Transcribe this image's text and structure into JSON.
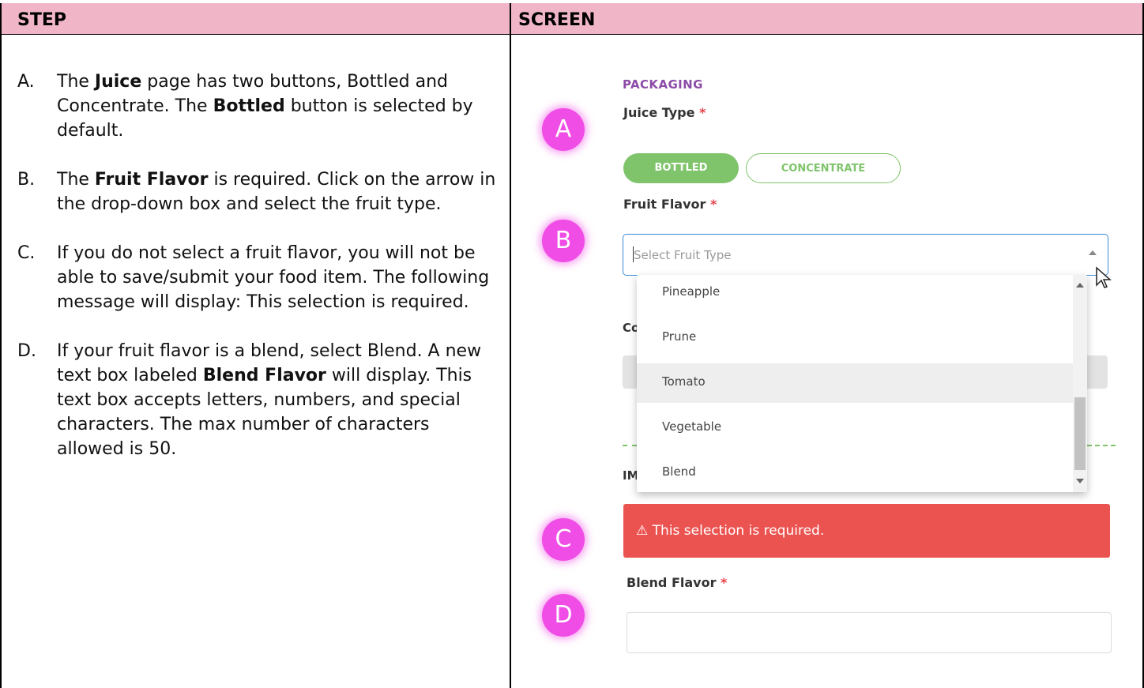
{
  "table": {
    "header_step": "STEP",
    "header_screen": "SCREEN"
  },
  "steps": [
    {
      "letter": "A.",
      "parts": [
        "The ",
        "Juice",
        " page has two buttons, Bottled and Concentrate.  The ",
        "Bottled",
        " button is selected by default."
      ]
    },
    {
      "letter": "B.",
      "parts": [
        "The ",
        "Fruit Flavor",
        " is required.  Click on the arrow in the drop-down box and select the fruit type."
      ]
    },
    {
      "letter": "C.",
      "parts": [
        "If you do not select a fruit flavor, you will not be able to save/submit your food item.  The following message will display:  This selection is required."
      ]
    },
    {
      "letter": "D.",
      "parts": [
        "If your fruit flavor is a blend, select Blend.  A new text box labeled ",
        "Blend Flavor",
        " will display.  This text box accepts letters, numbers, and special characters.  The max number of characters allowed is 50."
      ]
    }
  ],
  "screen": {
    "section_title": "PACKAGING",
    "juice_type_label": "Juice Type",
    "required_mark": "*",
    "btn_bottled": "BOTTLED",
    "btn_concentrate": "CONCENTRATE",
    "fruit_flavor_label": "Fruit Flavor",
    "select_placeholder": "Select Fruit Type",
    "options": [
      "Pineapple",
      "Prune",
      "Tomato",
      "Vegetable",
      "Blend"
    ],
    "highlighted_option": "Tomato",
    "hidden_label_partial": "Co",
    "hidden_label_partial2": "IM",
    "error_icon": "⚠",
    "error_text": "This selection is required.",
    "blend_flavor_label": "Blend Flavor",
    "badges": [
      "A",
      "B",
      "C",
      "D"
    ],
    "colors": {
      "header_bg": "#f0b6c8",
      "accent_green": "#7fc46a",
      "section_purple": "#8c4ca8",
      "error_red": "#eb5350",
      "badge_magenta": "#f04ce6",
      "required_red": "#e8434d",
      "select_border": "#3b8bd4"
    }
  }
}
